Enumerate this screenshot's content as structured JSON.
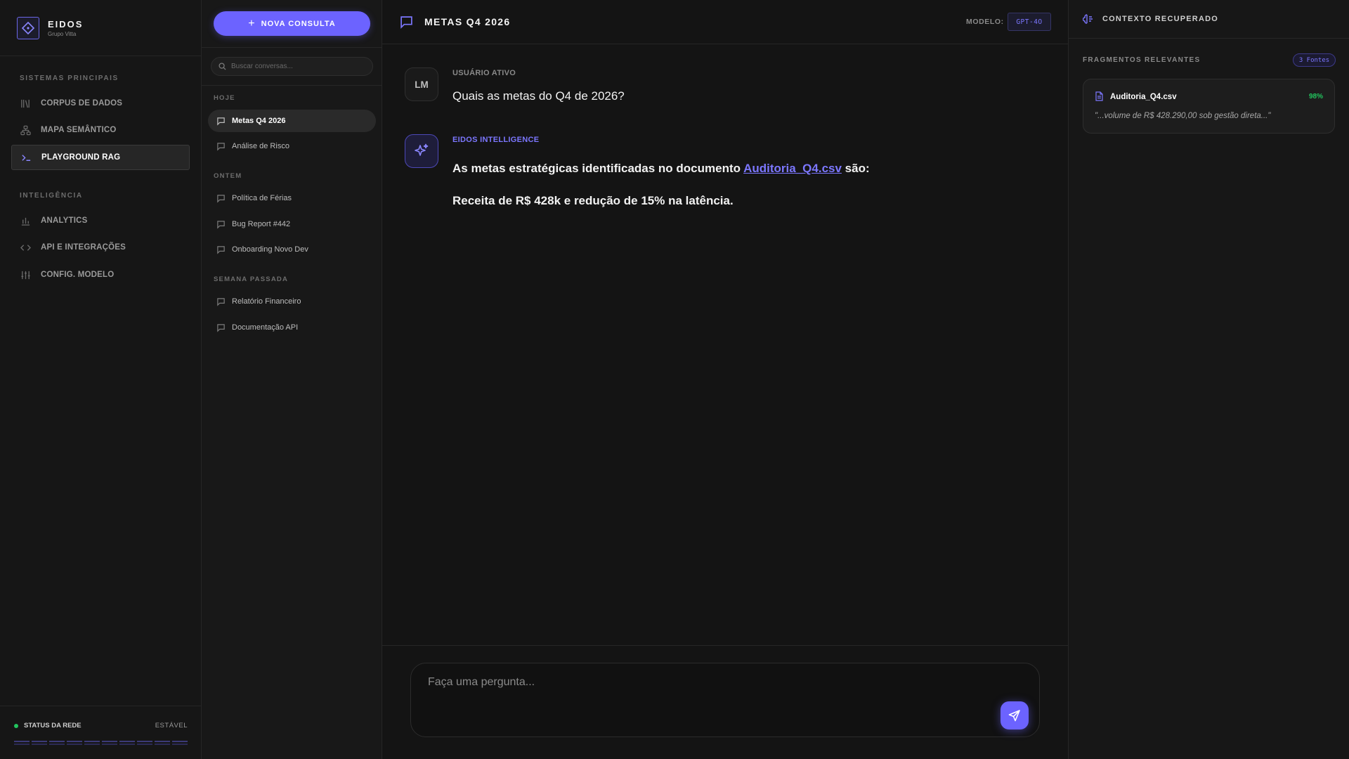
{
  "brand": {
    "name": "EIDOS",
    "subtitle": "Grupo Vitta"
  },
  "nav": {
    "section_main": "SISTEMAS PRINCIPAIS",
    "section_intel": "INTELIGÊNCIA",
    "items": [
      {
        "label": "CORPUS DE DADOS",
        "icon": "library-icon",
        "active": false
      },
      {
        "label": "MAPA SEMÂNTICO",
        "icon": "network-icon",
        "active": false
      },
      {
        "label": "PLAYGROUND RAG",
        "icon": "terminal-icon",
        "active": true
      },
      {
        "label": "ANALYTICS",
        "icon": "bar-chart-icon",
        "active": false
      },
      {
        "label": "API E INTEGRAÇÕES",
        "icon": "code-icon",
        "active": false
      },
      {
        "label": "CONFIG. MODELO",
        "icon": "sliders-icon",
        "active": false
      }
    ],
    "network": {
      "label": "STATUS DA REDE",
      "state": "ESTÁVEL",
      "status_color": "#22c55e"
    }
  },
  "conversations": {
    "new_button": "NOVA CONSULTA",
    "search_placeholder": "Buscar conversas...",
    "groups": {
      "today": "HOJE",
      "yesterday": "ONTEM",
      "last_week": "SEMANA PASSADA"
    },
    "items": [
      {
        "label": "Metas Q4 2026",
        "active": true
      },
      {
        "label": "Análise de Risco",
        "active": false
      },
      {
        "label": "Política de Férias",
        "active": false
      },
      {
        "label": "Bug Report #442",
        "active": false
      },
      {
        "label": "Onboarding Novo Dev",
        "active": false
      },
      {
        "label": "Relatório Financeiro",
        "active": false
      },
      {
        "label": "Documentação API",
        "active": false
      }
    ]
  },
  "chat": {
    "title": "METAS Q4 2026",
    "model_label": "MODELO:",
    "model_value": "GPT-4O",
    "messages": {
      "user_initials": "LM",
      "user_author": "USUÁRIO ATIVO",
      "user_text": "Quais as metas do Q4 de 2026?",
      "ai_author": "EIDOS INTELLIGENCE",
      "ai_text_before": "As metas estratégicas identificadas no documento",
      "ai_link": "Auditoria_Q4.csv",
      "ai_text_after": "são:",
      "ai_text_line2": "Receita de R$ 428k e redução de 15% na latência."
    },
    "composer_placeholder": "Faça uma pergunta..."
  },
  "context": {
    "title": "CONTEXTO RECUPERADO",
    "fragments_label": "FRAGMENTOS RELEVANTES",
    "fragments_count": "3 Fontes",
    "sources": [
      {
        "name": "Auditoria_Q4.csv",
        "score": "98%",
        "quote": "\"...volume de R$ 428.290,00 sob gestão direta...\""
      }
    ]
  },
  "colors": {
    "accent": "#6c63ff",
    "accent_text": "#7c77ff",
    "success": "#22c55e",
    "background": "#141414"
  }
}
